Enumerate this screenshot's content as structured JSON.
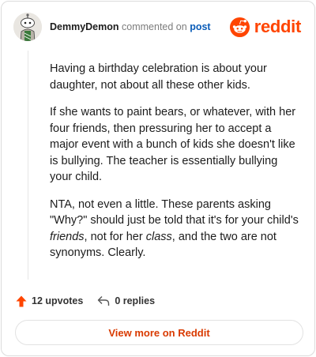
{
  "header": {
    "username": "DemmyDemon",
    "action_text": "commented on",
    "post_link": "post",
    "brand": "reddit"
  },
  "comment": {
    "paragraphs": [
      [
        {
          "text": "Having a birthday celebration is about your daughter, not about all these other kids.",
          "italic": false
        }
      ],
      [
        {
          "text": "If she wants to paint bears, or whatever, with her four friends, then pressuring her to accept a major event with a bunch of kids she doesn't like is bullying. The teacher is essentially bullying your child.",
          "italic": false
        }
      ],
      [
        {
          "text": "NTA, not even a little. These parents asking \"Why?\" should just be told that it's for your child's ",
          "italic": false
        },
        {
          "text": "friends",
          "italic": true
        },
        {
          "text": ", not for her ",
          "italic": false
        },
        {
          "text": "class",
          "italic": true
        },
        {
          "text": ", and the two are not synonyms. Clearly.",
          "italic": false
        }
      ]
    ]
  },
  "actions": {
    "upvotes": "12 upvotes",
    "replies": "0 replies"
  },
  "footer": {
    "view_more": "View more on Reddit"
  },
  "colors": {
    "brand": "#ff4500",
    "link": "#0a5cb8",
    "cta": "#d93a00",
    "upvote": "#ff4500"
  },
  "icons": {
    "avatar": "snoo-avatar-icon",
    "brand": "reddit-snoo-icon",
    "upvote": "upvote-arrow-icon",
    "reply": "reply-arrow-icon"
  }
}
